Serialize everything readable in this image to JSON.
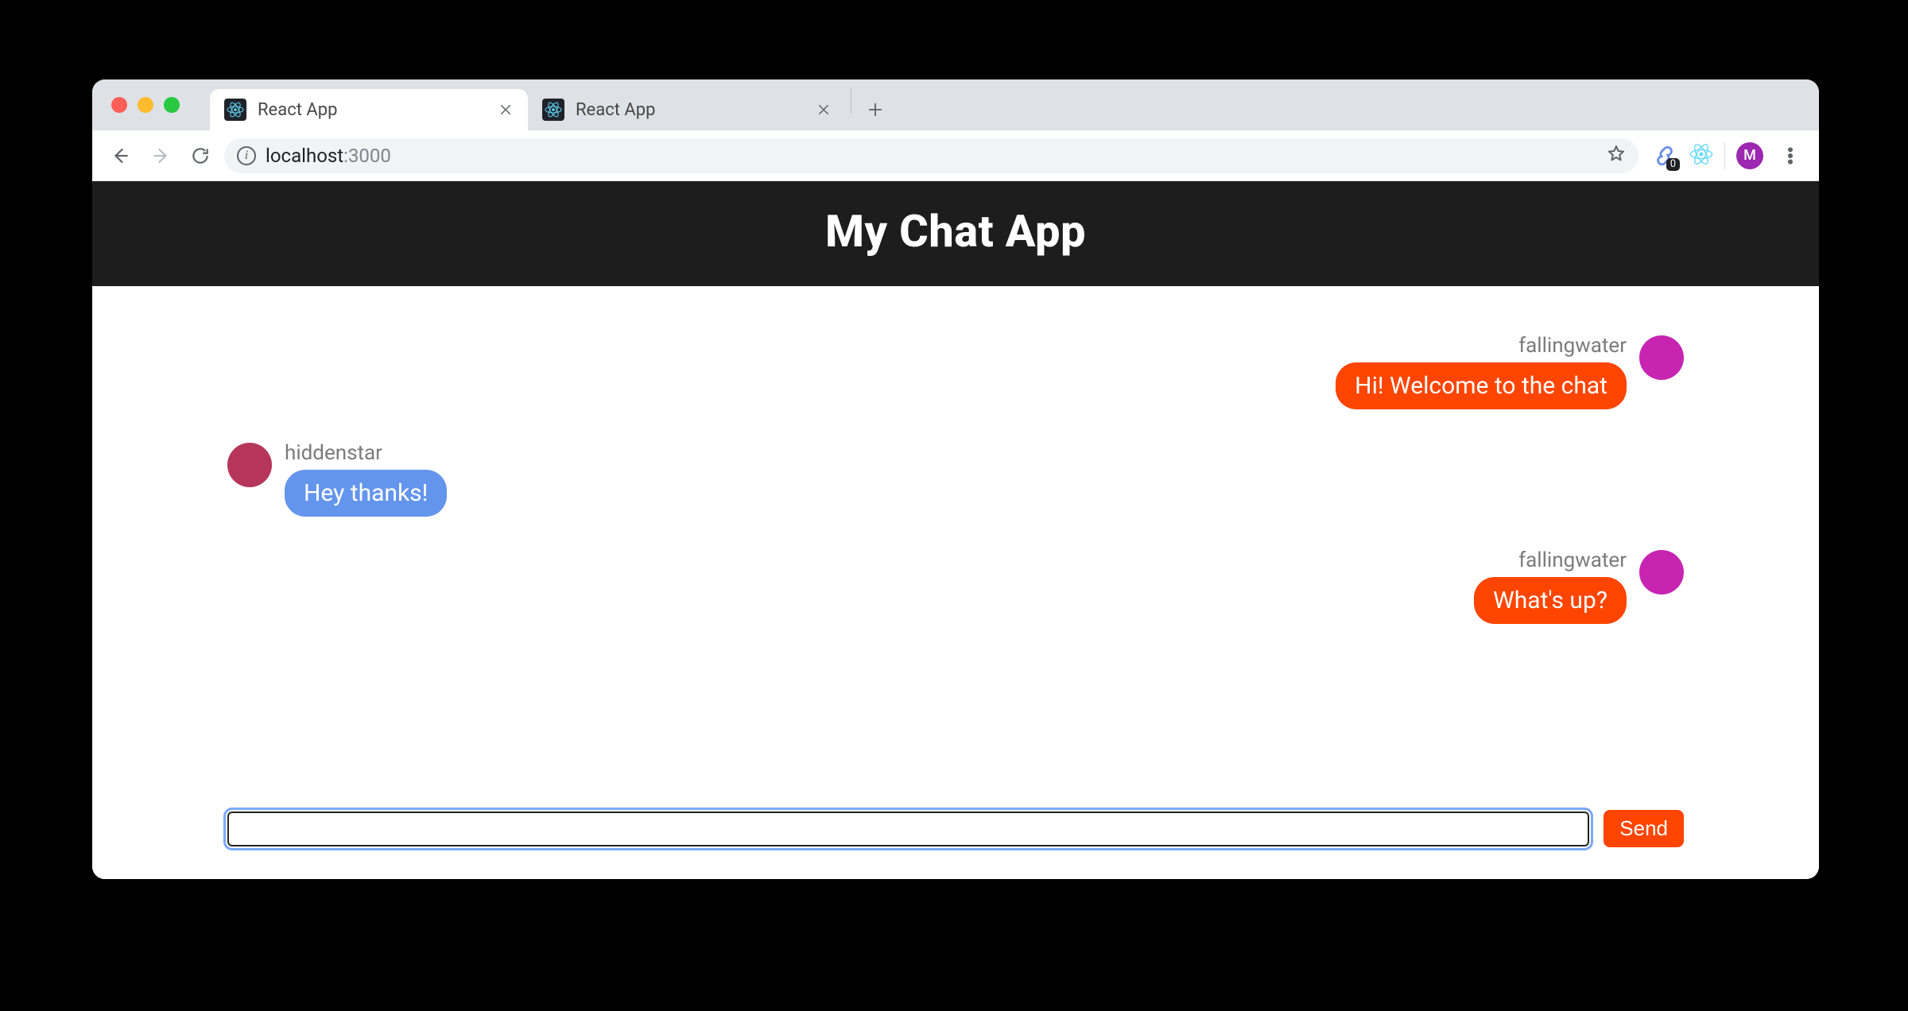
{
  "browser": {
    "tabs": [
      {
        "title": "React App",
        "active": true
      },
      {
        "title": "React App",
        "active": false
      }
    ],
    "addressbar": {
      "host": "localhost",
      "port": ":3000"
    },
    "link_extension_badge": "0",
    "profile_initial": "M"
  },
  "app": {
    "title": "My Chat App",
    "messages": [
      {
        "side": "right",
        "username": "fallingwater",
        "text": "Hi! Welcome to the chat",
        "bubble_color": "orange",
        "avatar_color": "#c724b1"
      },
      {
        "side": "left",
        "username": "hiddenstar",
        "text": "Hey thanks!",
        "bubble_color": "blue",
        "avatar_color": "#b6365b"
      },
      {
        "side": "right",
        "username": "fallingwater",
        "text": "What's up?",
        "bubble_color": "orange",
        "avatar_color": "#c724b1"
      }
    ],
    "compose": {
      "value": "",
      "placeholder": "",
      "send_label": "Send"
    }
  }
}
